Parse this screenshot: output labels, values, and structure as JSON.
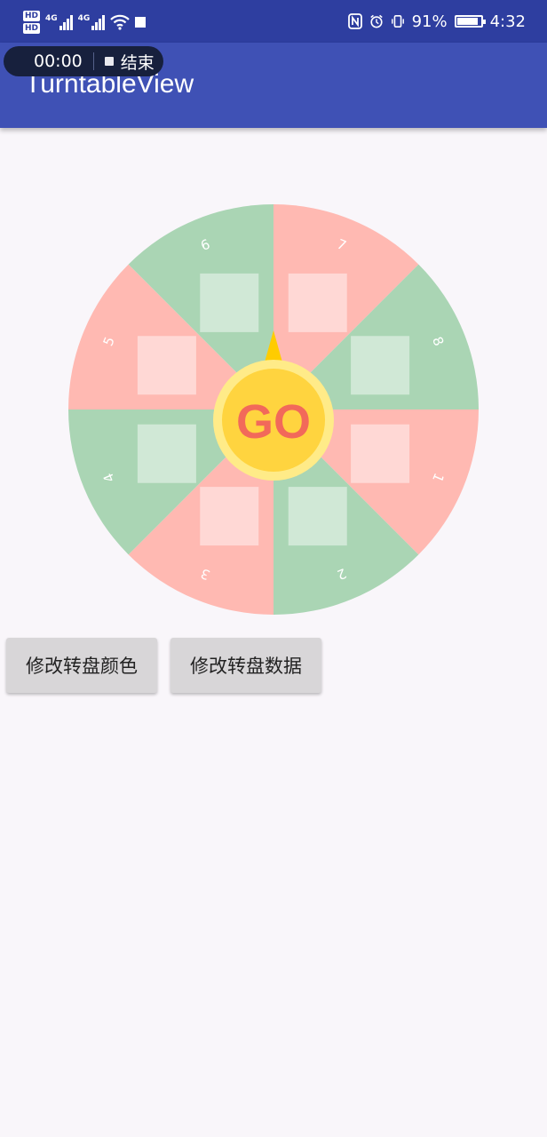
{
  "status_bar": {
    "hd_top": "HD",
    "hd_bottom": "HD",
    "network_1": "4G",
    "network_2": "4G",
    "battery_percent": "91%",
    "battery_level": 0.91,
    "time": "4:32"
  },
  "screen_recorder": {
    "time": "00:00",
    "stop_label": "结束"
  },
  "app_bar": {
    "title": "TurntableView"
  },
  "turntable": {
    "center_label": "GO",
    "segment_labels": [
      "7",
      "8",
      "1",
      "2",
      "3",
      "4",
      "5",
      "6"
    ],
    "colors": {
      "pink": "#ffb9b2",
      "green": "#aad5b4",
      "hub_outer": "#ffeb88",
      "hub_inner": "#ffd43f",
      "pointer": "#ffcc00",
      "go_text": "#f2695a"
    }
  },
  "buttons": {
    "change_color": "修改转盘颜色",
    "change_data": "修改转盘数据"
  }
}
